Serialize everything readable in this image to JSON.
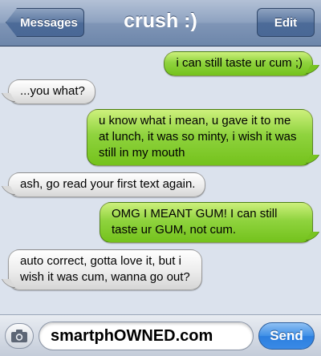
{
  "navbar": {
    "title": "crush :)",
    "back_label": "Messages",
    "edit_label": "Edit"
  },
  "messages": [
    {
      "from": "me",
      "text": "i can still taste ur cum ;)"
    },
    {
      "from": "them",
      "text": "...you what?"
    },
    {
      "from": "me",
      "text": "u know what i mean, u gave it to me at lunch, it was so minty, i wish it was still in my mouth"
    },
    {
      "from": "them",
      "text": "ash, go read your first text again."
    },
    {
      "from": "me",
      "text": "OMG I MEANT GUM! I can still taste ur GUM, not cum."
    },
    {
      "from": "them",
      "text": "auto correct, gotta love it, but i wish it was cum, wanna go out?"
    }
  ],
  "input": {
    "text": "smartphOWNED.com",
    "send_label": "Send"
  },
  "icons": {
    "camera": "camera-icon",
    "back": "chevron-left-icon"
  },
  "colors": {
    "sent_bubble": "#8fd33e",
    "received_bubble": "#ececec",
    "navbar": "#8fa3c1",
    "send_button": "#3f8fe6"
  }
}
